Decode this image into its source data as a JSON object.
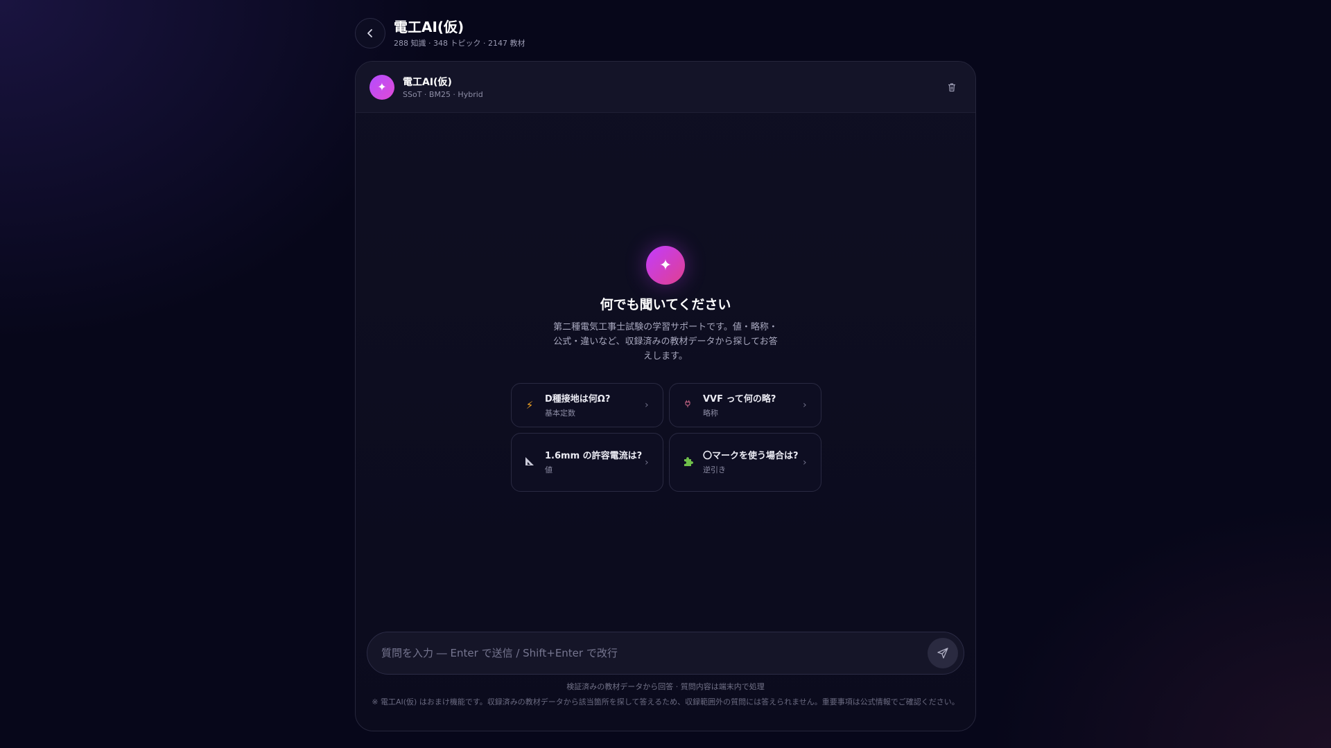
{
  "top_header": {
    "title": "電工AI(仮)",
    "subtitle": "288 知識 · 348 トピック · 2147 教材",
    "back_icon": "chevron-left-icon"
  },
  "chat_header": {
    "bot_name": "電工AI(仮)",
    "bot_meta": "SSoT · BM25 · Hybrid",
    "avatar_icon": "sparkle-icon",
    "delete_icon": "trash-icon"
  },
  "welcome": {
    "logo_icon": "sparkle-icon",
    "title": "何でも聞いてください",
    "description": "第二種電気工事士試験の学習サポートです。値・略称・公式・違いなど、収録済みの教材データから探してお答えします。"
  },
  "suggestions": [
    {
      "icon": "lightning-icon",
      "title": "D種接地は何Ω?",
      "category": "基本定数"
    },
    {
      "icon": "plug-icon",
      "title": "VVF って何の略?",
      "category": "略称"
    },
    {
      "icon": "ruler-triangle-icon",
      "title": "1.6mm の許容電流は?",
      "category": "値"
    },
    {
      "icon": "puzzle-icon",
      "title": "〇マークを使う場合は?",
      "category": "逆引き"
    }
  ],
  "input": {
    "placeholder": "質問を入力 ― Enter で送信 / Shift+Enter で改行",
    "value": "",
    "send_icon": "send-icon"
  },
  "footer": {
    "note": "検証済みの教材データから回答 · 質問内容は端末内で処理",
    "disclaimer": "※ 電工AI(仮) はおまけ機能です。収録済みの教材データから該当箇所を探して答えるため、収録範囲外の質問には答えられません。重要事項は公式情報でご確認ください。"
  },
  "colors": {
    "accent_gradient_start": "#b34cff",
    "accent_gradient_end": "#e04bd6",
    "background": "#07071a"
  }
}
